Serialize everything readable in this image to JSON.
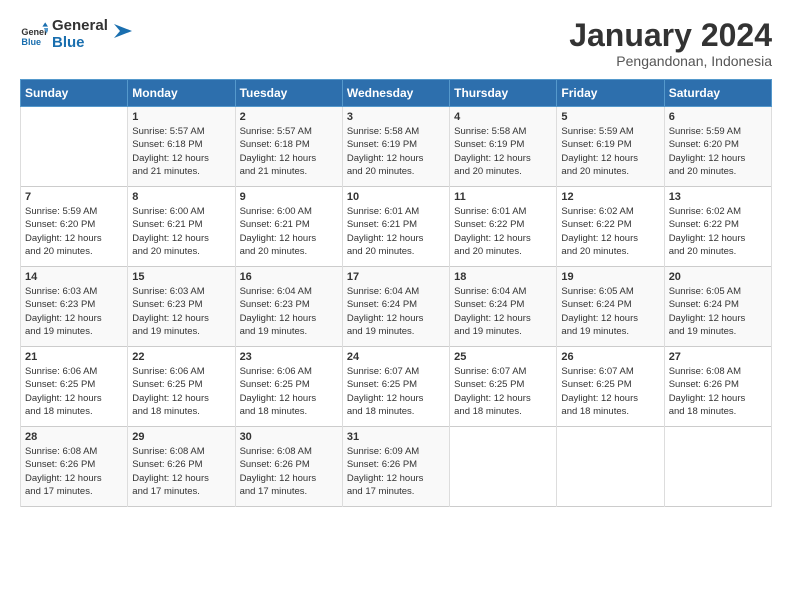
{
  "logo": {
    "line1": "General",
    "line2": "Blue"
  },
  "header": {
    "month": "January 2024",
    "location": "Pengandonan, Indonesia"
  },
  "days_of_week": [
    "Sunday",
    "Monday",
    "Tuesday",
    "Wednesday",
    "Thursday",
    "Friday",
    "Saturday"
  ],
  "weeks": [
    [
      {
        "day": "",
        "info": ""
      },
      {
        "day": "1",
        "info": "Sunrise: 5:57 AM\nSunset: 6:18 PM\nDaylight: 12 hours\nand 21 minutes."
      },
      {
        "day": "2",
        "info": "Sunrise: 5:57 AM\nSunset: 6:18 PM\nDaylight: 12 hours\nand 21 minutes."
      },
      {
        "day": "3",
        "info": "Sunrise: 5:58 AM\nSunset: 6:19 PM\nDaylight: 12 hours\nand 20 minutes."
      },
      {
        "day": "4",
        "info": "Sunrise: 5:58 AM\nSunset: 6:19 PM\nDaylight: 12 hours\nand 20 minutes."
      },
      {
        "day": "5",
        "info": "Sunrise: 5:59 AM\nSunset: 6:19 PM\nDaylight: 12 hours\nand 20 minutes."
      },
      {
        "day": "6",
        "info": "Sunrise: 5:59 AM\nSunset: 6:20 PM\nDaylight: 12 hours\nand 20 minutes."
      }
    ],
    [
      {
        "day": "7",
        "info": "Sunrise: 5:59 AM\nSunset: 6:20 PM\nDaylight: 12 hours\nand 20 minutes."
      },
      {
        "day": "8",
        "info": "Sunrise: 6:00 AM\nSunset: 6:21 PM\nDaylight: 12 hours\nand 20 minutes."
      },
      {
        "day": "9",
        "info": "Sunrise: 6:00 AM\nSunset: 6:21 PM\nDaylight: 12 hours\nand 20 minutes."
      },
      {
        "day": "10",
        "info": "Sunrise: 6:01 AM\nSunset: 6:21 PM\nDaylight: 12 hours\nand 20 minutes."
      },
      {
        "day": "11",
        "info": "Sunrise: 6:01 AM\nSunset: 6:22 PM\nDaylight: 12 hours\nand 20 minutes."
      },
      {
        "day": "12",
        "info": "Sunrise: 6:02 AM\nSunset: 6:22 PM\nDaylight: 12 hours\nand 20 minutes."
      },
      {
        "day": "13",
        "info": "Sunrise: 6:02 AM\nSunset: 6:22 PM\nDaylight: 12 hours\nand 20 minutes."
      }
    ],
    [
      {
        "day": "14",
        "info": "Sunrise: 6:03 AM\nSunset: 6:23 PM\nDaylight: 12 hours\nand 19 minutes."
      },
      {
        "day": "15",
        "info": "Sunrise: 6:03 AM\nSunset: 6:23 PM\nDaylight: 12 hours\nand 19 minutes."
      },
      {
        "day": "16",
        "info": "Sunrise: 6:04 AM\nSunset: 6:23 PM\nDaylight: 12 hours\nand 19 minutes."
      },
      {
        "day": "17",
        "info": "Sunrise: 6:04 AM\nSunset: 6:24 PM\nDaylight: 12 hours\nand 19 minutes."
      },
      {
        "day": "18",
        "info": "Sunrise: 6:04 AM\nSunset: 6:24 PM\nDaylight: 12 hours\nand 19 minutes."
      },
      {
        "day": "19",
        "info": "Sunrise: 6:05 AM\nSunset: 6:24 PM\nDaylight: 12 hours\nand 19 minutes."
      },
      {
        "day": "20",
        "info": "Sunrise: 6:05 AM\nSunset: 6:24 PM\nDaylight: 12 hours\nand 19 minutes."
      }
    ],
    [
      {
        "day": "21",
        "info": "Sunrise: 6:06 AM\nSunset: 6:25 PM\nDaylight: 12 hours\nand 18 minutes."
      },
      {
        "day": "22",
        "info": "Sunrise: 6:06 AM\nSunset: 6:25 PM\nDaylight: 12 hours\nand 18 minutes."
      },
      {
        "day": "23",
        "info": "Sunrise: 6:06 AM\nSunset: 6:25 PM\nDaylight: 12 hours\nand 18 minutes."
      },
      {
        "day": "24",
        "info": "Sunrise: 6:07 AM\nSunset: 6:25 PM\nDaylight: 12 hours\nand 18 minutes."
      },
      {
        "day": "25",
        "info": "Sunrise: 6:07 AM\nSunset: 6:25 PM\nDaylight: 12 hours\nand 18 minutes."
      },
      {
        "day": "26",
        "info": "Sunrise: 6:07 AM\nSunset: 6:25 PM\nDaylight: 12 hours\nand 18 minutes."
      },
      {
        "day": "27",
        "info": "Sunrise: 6:08 AM\nSunset: 6:26 PM\nDaylight: 12 hours\nand 18 minutes."
      }
    ],
    [
      {
        "day": "28",
        "info": "Sunrise: 6:08 AM\nSunset: 6:26 PM\nDaylight: 12 hours\nand 17 minutes."
      },
      {
        "day": "29",
        "info": "Sunrise: 6:08 AM\nSunset: 6:26 PM\nDaylight: 12 hours\nand 17 minutes."
      },
      {
        "day": "30",
        "info": "Sunrise: 6:08 AM\nSunset: 6:26 PM\nDaylight: 12 hours\nand 17 minutes."
      },
      {
        "day": "31",
        "info": "Sunrise: 6:09 AM\nSunset: 6:26 PM\nDaylight: 12 hours\nand 17 minutes."
      },
      {
        "day": "",
        "info": ""
      },
      {
        "day": "",
        "info": ""
      },
      {
        "day": "",
        "info": ""
      }
    ]
  ]
}
